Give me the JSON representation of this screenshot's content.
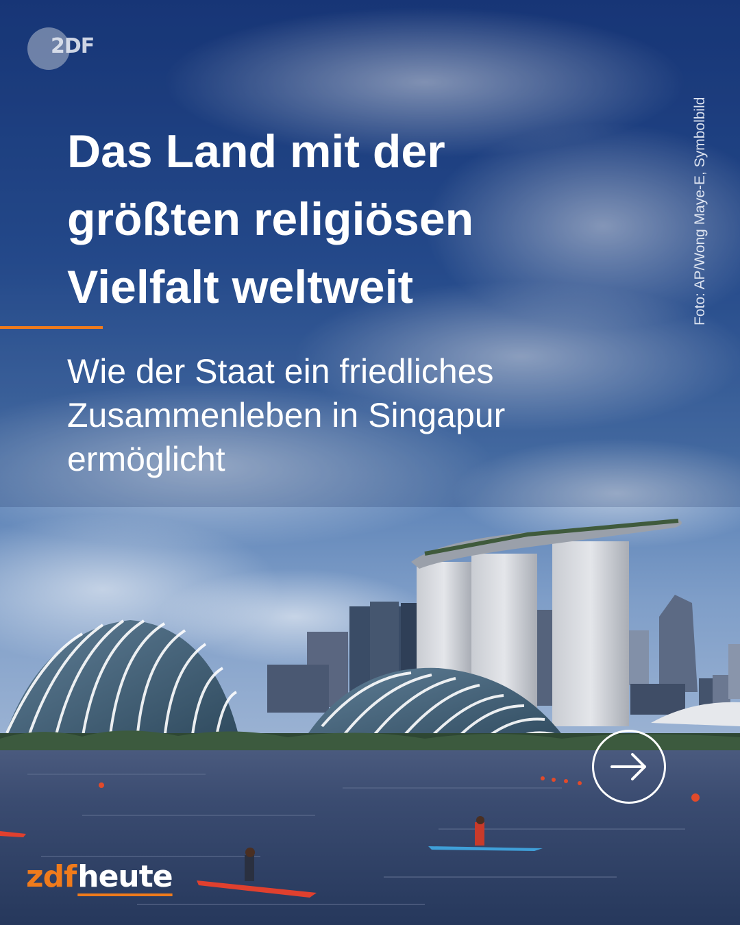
{
  "logo": {
    "badge_text": "2DF"
  },
  "photo_credit": "Foto: AP/Wong Maye-E, Symbolbild",
  "headline": {
    "lines": [
      "Das Land mit der",
      "größten religiösen",
      "Vielfalt weltweit"
    ]
  },
  "subtitle": {
    "lines": [
      "Wie der Staat ein friedliches",
      "Zusammenleben in Singapur",
      "ermöglicht"
    ]
  },
  "brand": {
    "zdf": "zdf",
    "heute": "heute"
  },
  "colors": {
    "accent": "#f07b1b",
    "sky_top": "#1c3f86",
    "water": "#34456a",
    "text": "#ffffff"
  },
  "icons": {
    "next": "arrow-right-circle-icon",
    "logo": "zdf-logo-icon"
  }
}
